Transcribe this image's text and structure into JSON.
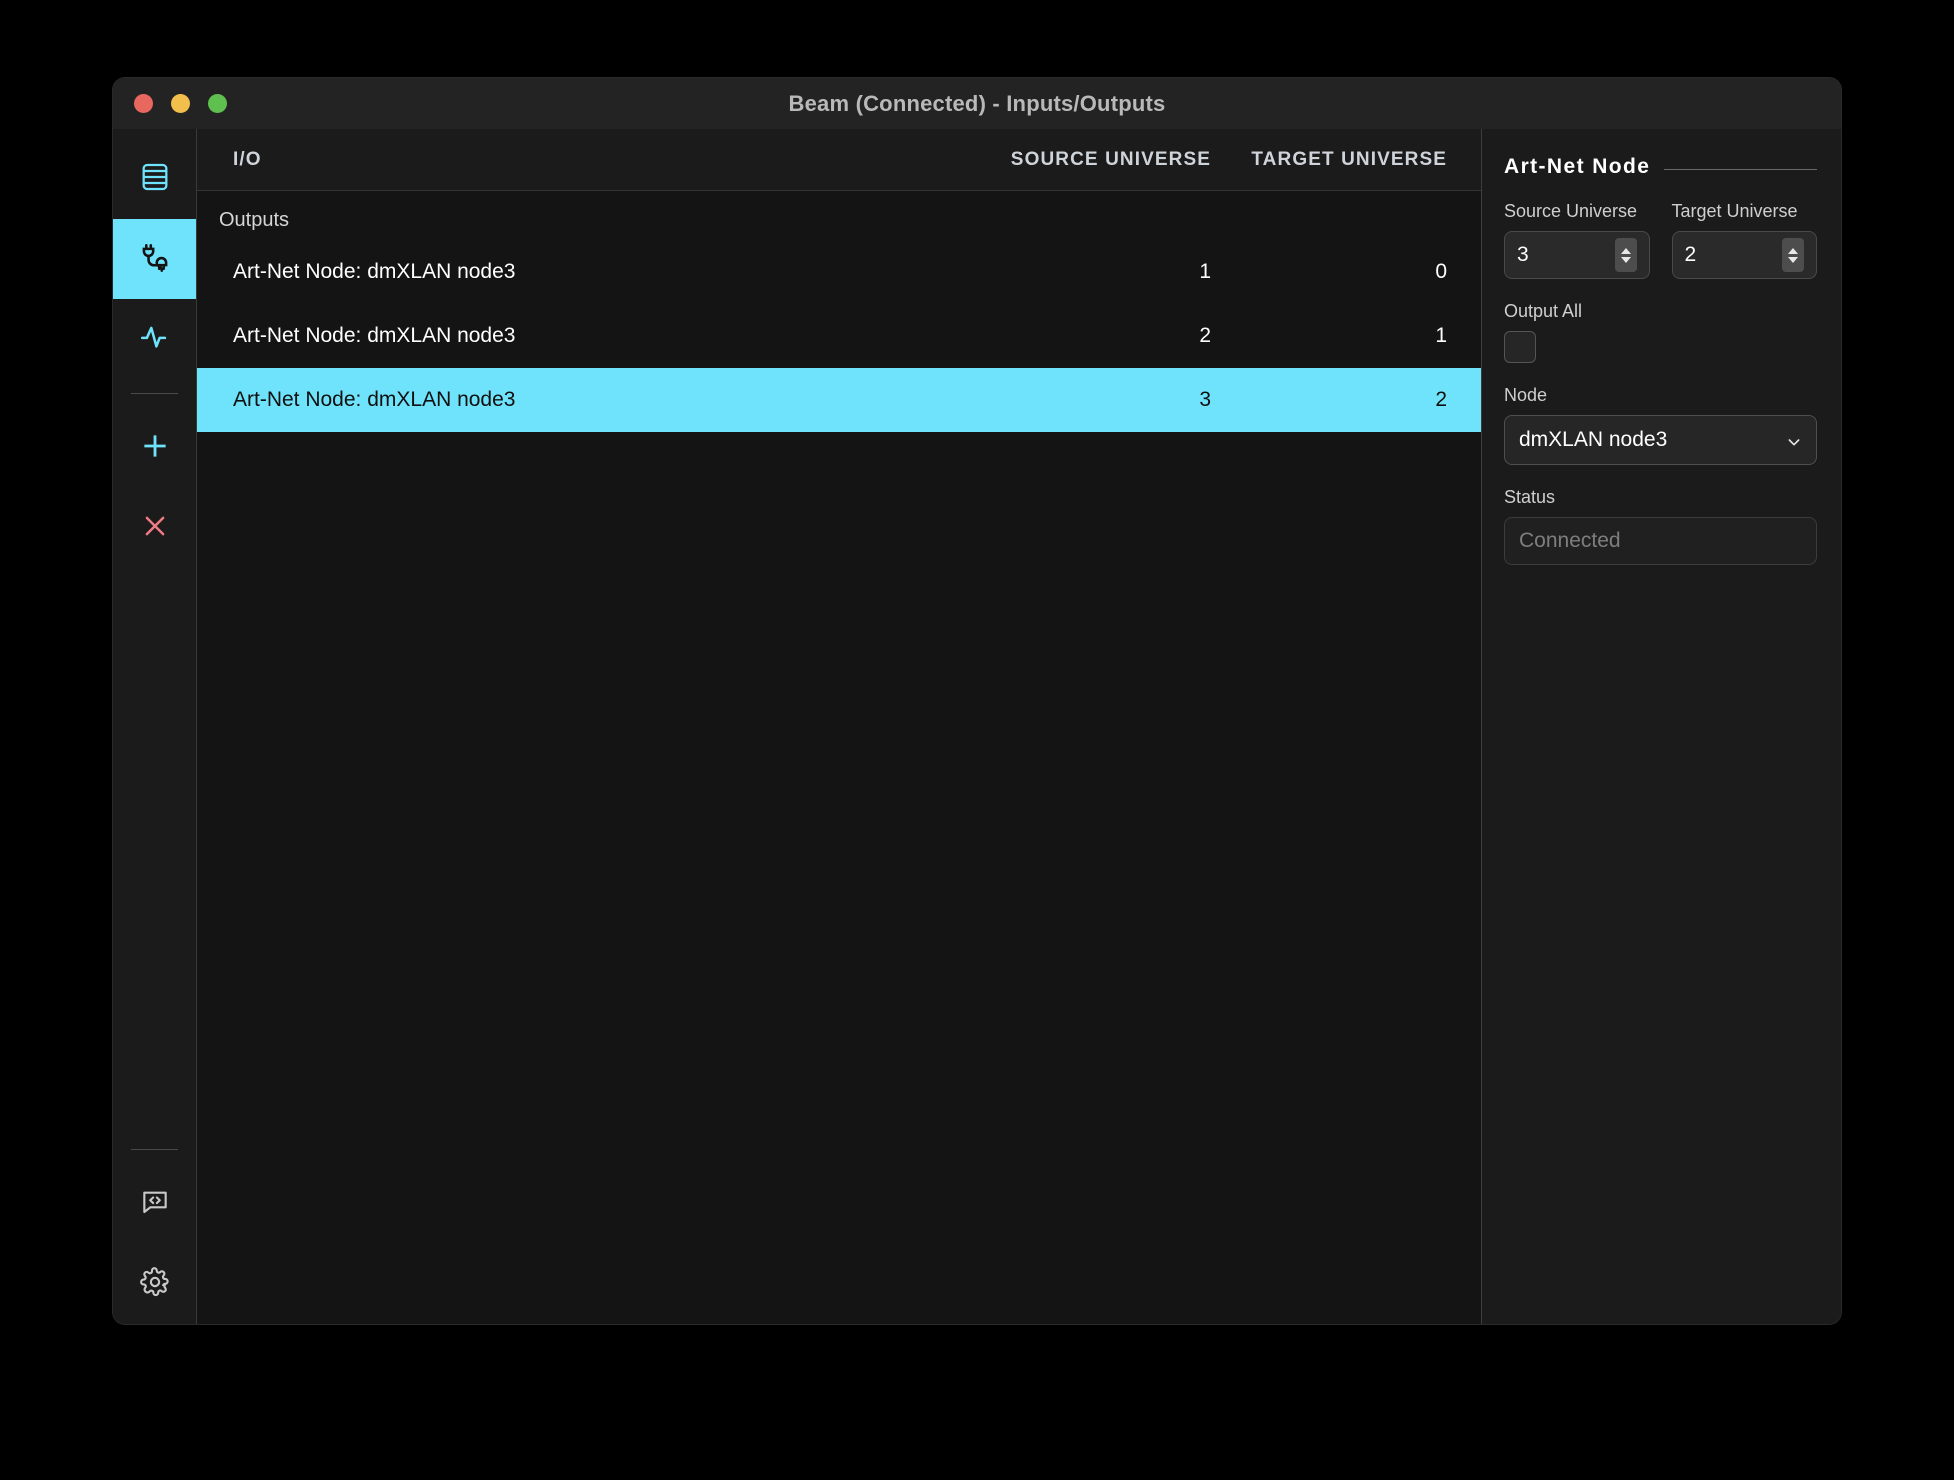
{
  "window": {
    "title": "Beam (Connected) - Inputs/Outputs",
    "traffic_lights": [
      {
        "name": "close",
        "color": "#e8685f"
      },
      {
        "name": "minimize",
        "color": "#f2be4c"
      },
      {
        "name": "maximize",
        "color": "#5fbf4f"
      }
    ]
  },
  "rail": {
    "items": [
      {
        "icon": "list-icon",
        "active": false
      },
      {
        "icon": "plug-cable-icon",
        "active": true
      },
      {
        "icon": "activity-pulse-icon",
        "active": false
      },
      {
        "icon": "plus-icon",
        "active": false
      },
      {
        "icon": "close-x-icon",
        "active": false
      },
      {
        "icon": "code-bubble-icon",
        "active": false
      },
      {
        "icon": "gear-icon",
        "active": false
      }
    ]
  },
  "table": {
    "headers": {
      "io": "I/O",
      "source_universe": "SOURCE UNIVERSE",
      "target_universe": "TARGET UNIVERSE"
    },
    "group_label": "Outputs",
    "rows": [
      {
        "io": "Art-Net Node: dmXLAN node3",
        "source": "1",
        "target": "0",
        "selected": false
      },
      {
        "io": "Art-Net Node: dmXLAN node3",
        "source": "2",
        "target": "1",
        "selected": false
      },
      {
        "io": "Art-Net Node: dmXLAN node3",
        "source": "3",
        "target": "2",
        "selected": true
      }
    ]
  },
  "inspector": {
    "title": "Art-Net Node",
    "source_universe_label": "Source Universe",
    "source_universe_value": "3",
    "target_universe_label": "Target Universe",
    "target_universe_value": "2",
    "output_all_label": "Output All",
    "output_all_checked": false,
    "node_label": "Node",
    "node_value": "dmXLAN node3",
    "status_label": "Status",
    "status_value": "Connected"
  },
  "colors": {
    "accent": "#6fe3fb",
    "danger": "#ef7b84",
    "window_bg": "#1b1b1b",
    "table_bg": "#141414"
  }
}
